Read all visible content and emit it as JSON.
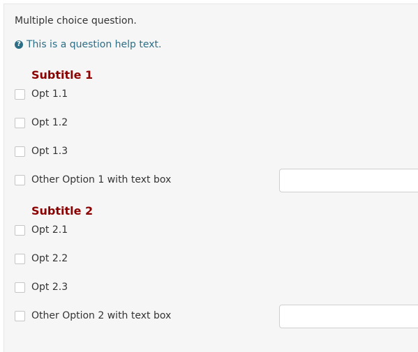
{
  "question": {
    "text": "Multiple choice question.",
    "help_text": "This is a question help text.",
    "help_icon": "question-circle-icon"
  },
  "groups": [
    {
      "subtitle": "Subtitle 1",
      "options": [
        "Opt 1.1",
        "Opt 1.2",
        "Opt 1.3"
      ],
      "other": {
        "label": "Other Option 1 with text box",
        "value": ""
      }
    },
    {
      "subtitle": "Subtitle 2",
      "options": [
        "Opt 2.1",
        "Opt 2.2",
        "Opt 2.3"
      ],
      "other": {
        "label": "Other Option 2 with text box",
        "value": ""
      }
    }
  ],
  "colors": {
    "subtitle": "#8b0000",
    "help": "#2c6e86",
    "panel_bg": "#f6f6f6"
  }
}
